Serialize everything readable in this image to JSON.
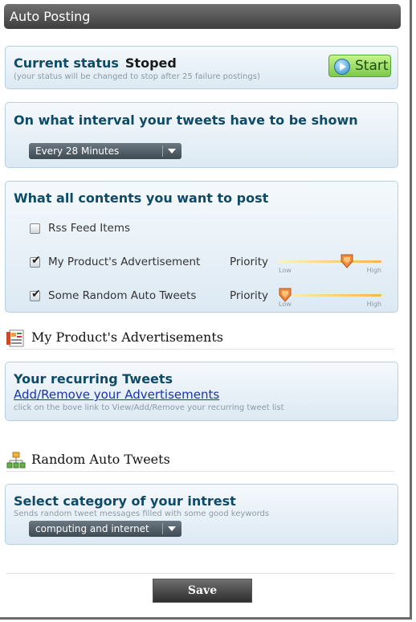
{
  "window": {
    "title": "Auto Posting"
  },
  "status_panel": {
    "label": "Current status",
    "value": "Stoped",
    "note": "(your status will be changed to stop after 25 failure postings)",
    "start_label": "Start"
  },
  "interval_panel": {
    "title": "On what interval your tweets have to be shown",
    "selected": "Every 28 Minutes"
  },
  "contents_panel": {
    "title": "What all contents you want to post",
    "items": [
      {
        "label": "Rss Feed Items",
        "checked": false,
        "check_glyph": ""
      },
      {
        "label": "My Product's Advertisement",
        "checked": true,
        "check_glyph": "✔",
        "priority_label": "Priority",
        "priority": 0.75,
        "low": "Low",
        "high": "High"
      },
      {
        "label": "Some Random Auto Tweets",
        "checked": true,
        "check_glyph": "✔",
        "priority_label": "Priority",
        "priority": 0.0,
        "low": "Low",
        "high": "High"
      }
    ]
  },
  "ads_section": {
    "heading": "My Product's Advertisements",
    "panel_title": "Your recurring Tweets",
    "link": "Add/Remove your Advertisements",
    "note": "click on the bove link to View/Add/Remove your recurring tweet list"
  },
  "random_section": {
    "heading": "Random Auto Tweets",
    "panel_title": "Select category of your intrest",
    "note": "Sends random tweet messages filled with some good keywords",
    "selected": "computing and internet"
  },
  "save_label": "Save",
  "colors": {
    "title_bar": "#4a4a4a",
    "panel_title": "#0f4a66",
    "link": "#1a33a6",
    "start_green": "#7cc84a"
  },
  "icons": [
    "play-icon",
    "chevron-down-icon",
    "checkbox-icon",
    "slider-thumb-icon",
    "document-icon",
    "sitemap-icon"
  ]
}
